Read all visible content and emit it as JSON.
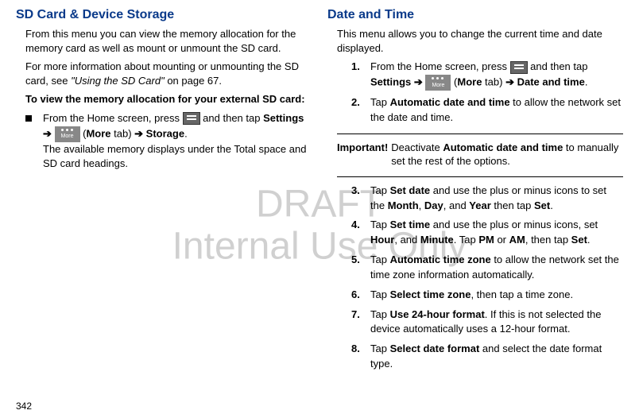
{
  "watermark": {
    "line1": "DRAFT",
    "line2": "Internal Use Only"
  },
  "page_number": "342",
  "left": {
    "heading": "SD Card & Device Storage",
    "p1": "From this menu you can view the memory allocation for the memory card as well as mount or unmount the SD card.",
    "p2_a": "For more information about mounting or unmounting the SD card, see ",
    "p2_i": "\"Using the SD Card\"",
    "p2_b": " on page 67.",
    "p3": "To view the memory allocation for your external SD card:",
    "bullet": {
      "a": "From the Home screen, press ",
      "b": " and then tap ",
      "settings": "Settings",
      "arrow": " ➔ ",
      "more_tab_open": " (",
      "more": "More",
      "more_tab_close": " tab) ",
      "storage": "Storage",
      "period": ".",
      "line2": "The available memory displays under the Total space and SD card headings."
    }
  },
  "right": {
    "heading": "Date and Time",
    "p1": "This menu allows you to change the current time and date displayed.",
    "s1": {
      "num": "1.",
      "a": "From the Home screen, press ",
      "b": " and then tap ",
      "settings": "Settings",
      "arrow": " ➔ ",
      "more_tab_open": " (",
      "more": "More",
      "more_tab_close": " tab) ",
      "arrow2": "➔ ",
      "dt": "Date and time",
      "period": "."
    },
    "s2": {
      "num": "2.",
      "a": "Tap ",
      "b1": "Automatic date and time",
      "c": " to allow the network set the date and time."
    },
    "important_label": "Important!",
    "important_a": " Deactivate ",
    "important_b": "Automatic date and time",
    "important_c": " to manually set the rest of the options.",
    "s3": {
      "num": "3.",
      "a": "Tap ",
      "b1": "Set date",
      "c": " and use the plus or minus icons to set the ",
      "b2": "Month",
      "d": ", ",
      "b3": "Day",
      "e": ", and ",
      "b4": "Year",
      "f": " then tap ",
      "b5": "Set",
      "g": "."
    },
    "s4": {
      "num": "4.",
      "a": "Tap ",
      "b1": "Set time",
      "c": " and use the plus or minus icons, set ",
      "b2": "Hour",
      "d": ", and ",
      "b3": "Minute",
      "e": ". Tap ",
      "b4": "PM",
      "f": " or ",
      "b5": "AM",
      "g": ", then tap ",
      "b6": "Set",
      "h": "."
    },
    "s5": {
      "num": "5.",
      "a": "Tap ",
      "b1": "Automatic time zone",
      "c": " to allow the network set the time zone information automatically."
    },
    "s6": {
      "num": "6.",
      "a": "Tap ",
      "b1": "Select time zone",
      "c": ", then tap a time zone."
    },
    "s7": {
      "num": "7.",
      "a": "Tap ",
      "b1": "Use 24-hour format",
      "c": ". If this is not selected the device automatically uses a 12-hour format."
    },
    "s8": {
      "num": "8.",
      "a": "Tap ",
      "b1": "Select date format",
      "c": " and select the date format type."
    }
  }
}
